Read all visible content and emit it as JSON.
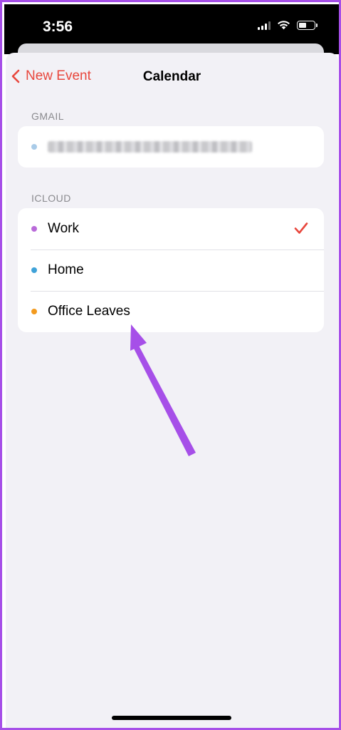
{
  "status_bar": {
    "time": "3:56"
  },
  "nav": {
    "back_label": "New Event",
    "title": "Calendar"
  },
  "sections": [
    {
      "header": "GMAIL",
      "items": [
        {
          "label": "",
          "dot_color": "#a9cbe8",
          "blurred": true
        }
      ]
    },
    {
      "header": "ICLOUD",
      "items": [
        {
          "label": "Work",
          "dot_color": "#b96ad9",
          "selected": true
        },
        {
          "label": "Home",
          "dot_color": "#3fa2d8",
          "selected": false
        },
        {
          "label": "Office Leaves",
          "dot_color": "#f39a1e",
          "selected": false
        }
      ]
    }
  ],
  "colors": {
    "accent": "#e8473d",
    "annotation": "#a64fe8"
  },
  "icons": {
    "back": "chevron-left-icon",
    "check": "checkmark-icon",
    "annotation": "arrow-icon"
  }
}
